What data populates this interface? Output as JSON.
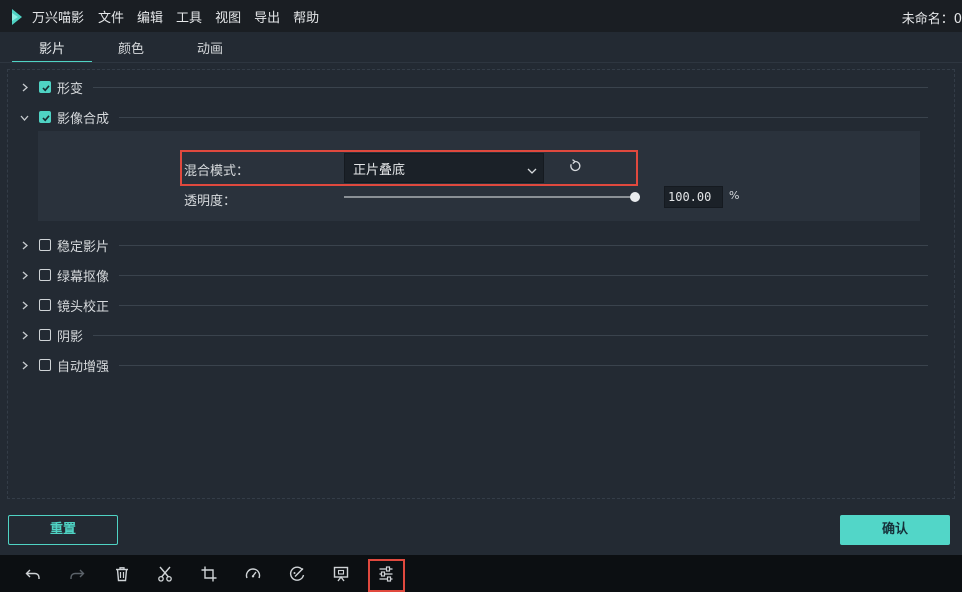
{
  "app": {
    "name": "万兴喵影",
    "doc_title": "未命名：0"
  },
  "menu": [
    "文件",
    "编辑",
    "工具",
    "视图",
    "导出",
    "帮助"
  ],
  "tabs": [
    "影片",
    "颜色",
    "动画"
  ],
  "sections": [
    {
      "label": "形变",
      "checked": true,
      "expanded": false
    },
    {
      "label": "影像合成",
      "checked": true,
      "expanded": true
    },
    {
      "label": "稳定影片",
      "checked": false,
      "expanded": false
    },
    {
      "label": "绿幕抠像",
      "checked": false,
      "expanded": false
    },
    {
      "label": "镜头校正",
      "checked": false,
      "expanded": false
    },
    {
      "label": "阴影",
      "checked": false,
      "expanded": false
    },
    {
      "label": "自动增强",
      "checked": false,
      "expanded": false
    }
  ],
  "compositing": {
    "blend_label": "混合模式：",
    "blend_value": "正片叠底",
    "opacity_label": "透明度：",
    "opacity_value": "100.00",
    "opacity_unit": "%",
    "opacity_fraction": 1.0
  },
  "buttons": {
    "reset": "重置",
    "ok": "确认"
  },
  "toolbar": [
    "undo-icon",
    "redo-icon",
    "delete-icon",
    "cut-icon",
    "crop-icon",
    "speed-icon",
    "color-icon",
    "screen-icon",
    "adjust-icon"
  ],
  "colors": {
    "accent": "#4fd3c4",
    "highlight": "#e0493e",
    "panel": "#232a33"
  }
}
